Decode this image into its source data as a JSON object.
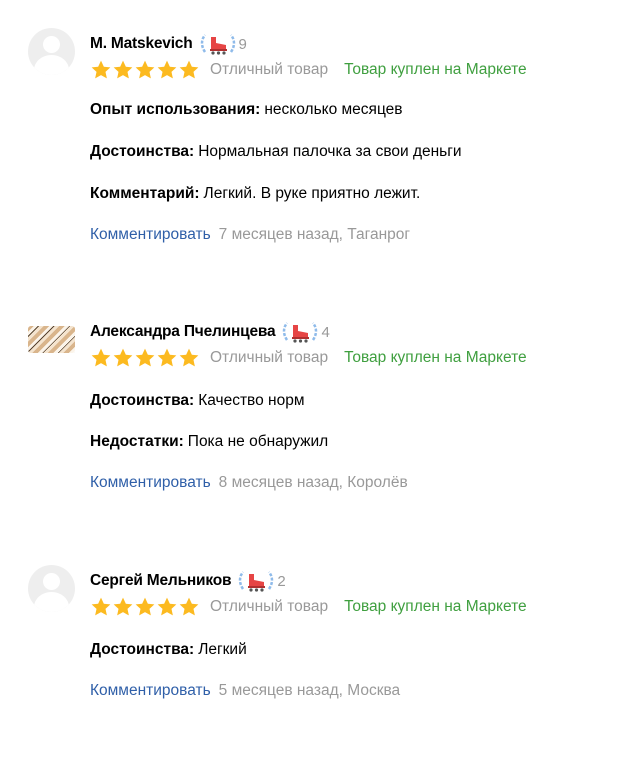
{
  "badge_colors": {
    "laurel": "#8fbbea",
    "skate": "#e64545"
  },
  "reviews": [
    {
      "author": "M. Matskevich",
      "avatar": "placeholder-avatar",
      "badge_count": "9",
      "grade": "Отличный товар",
      "purchase": "Товар куплен на Маркете",
      "rating": 5,
      "fields": [
        {
          "label": "Опыт использования:",
          "value": "несколько месяцев"
        },
        {
          "label": "Достоинства:",
          "value": "Нормальная палочка за свои деньги"
        },
        {
          "label": "Комментарий:",
          "value": "Легкий. В руке приятно лежит."
        }
      ],
      "comment_link": "Комментировать",
      "meta": "7 месяцев назад, Таганрог"
    },
    {
      "author": "Александра Пчелинцева",
      "avatar": "photo-avatar",
      "badge_count": "4",
      "grade": "Отличный товар",
      "purchase": "Товар куплен на Маркете",
      "rating": 5,
      "fields": [
        {
          "label": "Достоинства:",
          "value": "Качество норм"
        },
        {
          "label": "Недостатки:",
          "value": "Пока не обнаружил"
        }
      ],
      "comment_link": "Комментировать",
      "meta": "8 месяцев назад, Королёв"
    },
    {
      "author": "Сергей Мельников",
      "avatar": "placeholder-avatar",
      "badge_count": "2",
      "grade": "Отличный товар",
      "purchase": "Товар куплен на Маркете",
      "rating": 5,
      "fields": [
        {
          "label": "Достоинства:",
          "value": "Легкий"
        }
      ],
      "comment_link": "Комментировать",
      "meta": "5 месяцев назад, Москва"
    }
  ]
}
